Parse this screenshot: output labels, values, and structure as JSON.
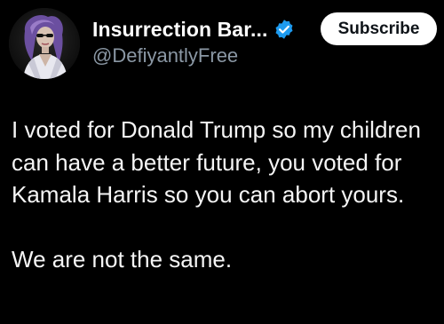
{
  "author": {
    "display_name": "Insurrection Bar...",
    "handle": "@DefiyantlyFree",
    "verified_icon": "verified-badge-icon",
    "avatar": "profile-avatar"
  },
  "actions": {
    "subscribe_label": "Subscribe"
  },
  "post": {
    "paragraph_1": "I voted for Donald Trump so my children can have a better future, you voted for Kamala Harris so you can abort yours.",
    "paragraph_2": "We are not the same."
  },
  "colors": {
    "background": "#000000",
    "text": "#e7e9ea",
    "secondary_text": "#8b98a5",
    "verified_blue": "#1d9bf0",
    "button_bg": "#ffffff",
    "button_text": "#0f1419"
  }
}
